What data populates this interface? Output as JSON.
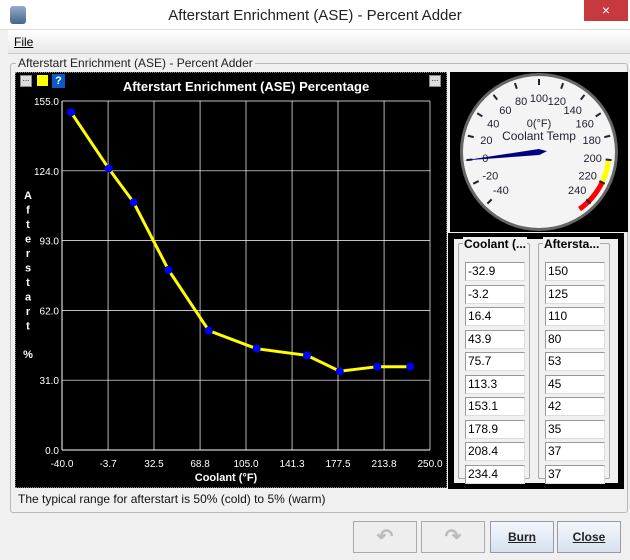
{
  "window": {
    "title": "Afterstart Enrichment (ASE) - Percent Adder",
    "close_icon": "×"
  },
  "menu": {
    "file": "File"
  },
  "group": {
    "title": "Afterstart Enrichment (ASE) - Percent Adder"
  },
  "chart_data": {
    "type": "line",
    "title": "Afterstart Enrichment (ASE) Percentage",
    "xlabel": "Coolant (°F)",
    "ylabel": "Afterstart %",
    "xlim": [
      -40.0,
      250.0
    ],
    "ylim": [
      0.0,
      155.0
    ],
    "xticks": [
      "-40.0",
      "-3.7",
      "32.5",
      "68.8",
      "105.0",
      "141.3",
      "177.5",
      "213.8",
      "250.0"
    ],
    "yticks": [
      "0.0",
      "31.0",
      "62.0",
      "93.0",
      "124.0",
      "155.0"
    ],
    "grid": true,
    "line_color": "#ffff00",
    "point_color": "#0000ff",
    "x": [
      -32.9,
      -3.2,
      16.4,
      43.9,
      75.7,
      113.3,
      153.1,
      178.9,
      208.4,
      234.4
    ],
    "y": [
      150,
      125,
      110,
      80,
      53,
      45,
      42,
      35,
      37,
      37
    ]
  },
  "gauge": {
    "label": "Coolant Temp",
    "value_text": "0(°F)",
    "value": 0,
    "min": -40,
    "max": 240,
    "ticks": [
      "-40",
      "-20",
      "0",
      "20",
      "40",
      "60",
      "80",
      "100",
      "120",
      "140",
      "160",
      "180",
      "200",
      "220",
      "240"
    ],
    "warn_color": "#ffff00",
    "danger_color": "#ff0000",
    "needle_color": "#00007f"
  },
  "table": {
    "col1_header": "Coolant (...",
    "col2_header": "Aftersta...",
    "coolant": [
      "-32.9",
      "-3.2",
      "16.4",
      "43.9",
      "75.7",
      "113.3",
      "153.1",
      "178.9",
      "208.4",
      "234.4"
    ],
    "afterstart": [
      "150",
      "125",
      "110",
      "80",
      "53",
      "45",
      "42",
      "35",
      "37",
      "37"
    ]
  },
  "status": "The typical range for afterstart is 50% (cold) to 5% (warm)",
  "buttons": {
    "undo": "undo-icon",
    "redo": "redo-icon",
    "burn": "Burn",
    "close": "Close"
  }
}
